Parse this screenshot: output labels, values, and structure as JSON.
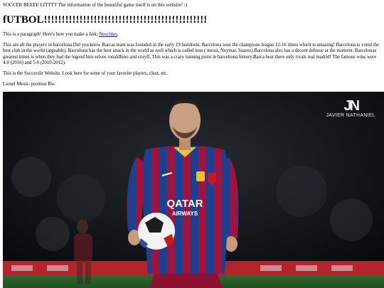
{
  "header": {
    "tagline": "SOCCER BEEEE LITTTT The information of the beautiful game itself is on this website! :)",
    "title": "fUTBOL!!!!!!!!!!!!!!!!!!!!!!!!!!!!!!!!!!!!!!!!!!!!!!"
  },
  "content": {
    "paragraph_intro": "This is a paragraph! Here's how you make a link: ",
    "link_text": "Neocities",
    "paragraph_intro_end": ".",
    "barcelona_text": "This are all the players in barcelona.Did you know Barcas team was founded in the early 19 hundreds. Barcelona won the champions league 12-16 times which is amazing! Barcelona is voted the best club in the world (arguable). Barcelona has the best attack in the world as well which is called msn ( messi, Neymar, Suarez).Barcelona also has a decent defense at the moment. Barcelonas greatest times is when they had the legend him selves ronaldhino and cruyff. This was a crazy tunning point in barceliona history.Barca beat there only rivals real madrid! The famous wins were 4-0 (2016) and 5-0 (2010-2012).",
    "site_text": "This is the Soccerslit Website. Look here for some of your favorite players, cleat, etc.",
    "player_caption": "Lionel Messi- position Rw."
  },
  "photo": {
    "watermark_mark": "JN",
    "watermark_name": "JAVIER NATHANIEL",
    "sponsor_top": "QATAR",
    "sponsor_bottom": "AIRWAYS",
    "colors": {
      "stripe_blue": "#1f3f8f",
      "stripe_red": "#a3123a",
      "shorts": "#8c1030",
      "pitch": "#2a5e2a",
      "board": "#b3242f"
    }
  }
}
